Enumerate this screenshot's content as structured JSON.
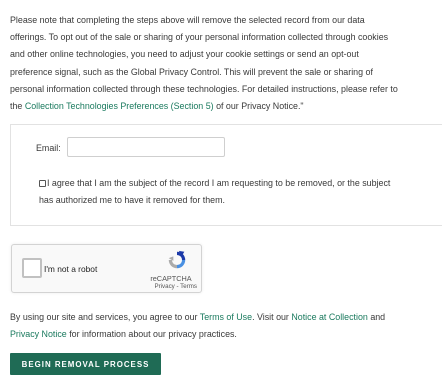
{
  "notice": {
    "line1": "Please note that completing the steps above will remove the selected record from our data",
    "line2": "offerings. To opt out of the sale or sharing of your personal information collected through cookies",
    "line3": "and other online technologies, you need to adjust your cookie settings or send an opt-out",
    "line4": "preference signal, such as the Global Privacy Control. This will prevent the sale or sharing of",
    "line5": "personal information collected through these technologies. For detailed instructions, please refer to",
    "line6_prefix": "the",
    "line6_link": "Collection Technologies Preferences (Section 5)",
    "line6_suffix": "of our Privacy Notice.\""
  },
  "form": {
    "email_label": "Email:",
    "email_value": "",
    "consent_line1": "I agree that I am the subject of the record I am requesting to be removed, or the subject",
    "consent_line2": "has authorized me to have it removed for them.",
    "consent_checked": false
  },
  "recaptcha": {
    "label": "I'm not a robot",
    "brand": "reCAPTCHA",
    "privacy": "Privacy",
    "separator": " - ",
    "terms": "Terms",
    "checked": false
  },
  "footer": {
    "part1": "By using our site and services, you agree to our",
    "terms_link": "Terms of Use",
    "part2": ". Visit our",
    "notice_collection_link": "Notice at Collection",
    "part3": "and",
    "privacy_link": "Privacy Notice",
    "part4": "for information about our privacy practices."
  },
  "submit_button": {
    "label": "Begin Removal Process"
  },
  "colors": {
    "link": "#1a7a5e",
    "button_bg": "#1f6b55",
    "body_text": "#3a3a3a"
  }
}
